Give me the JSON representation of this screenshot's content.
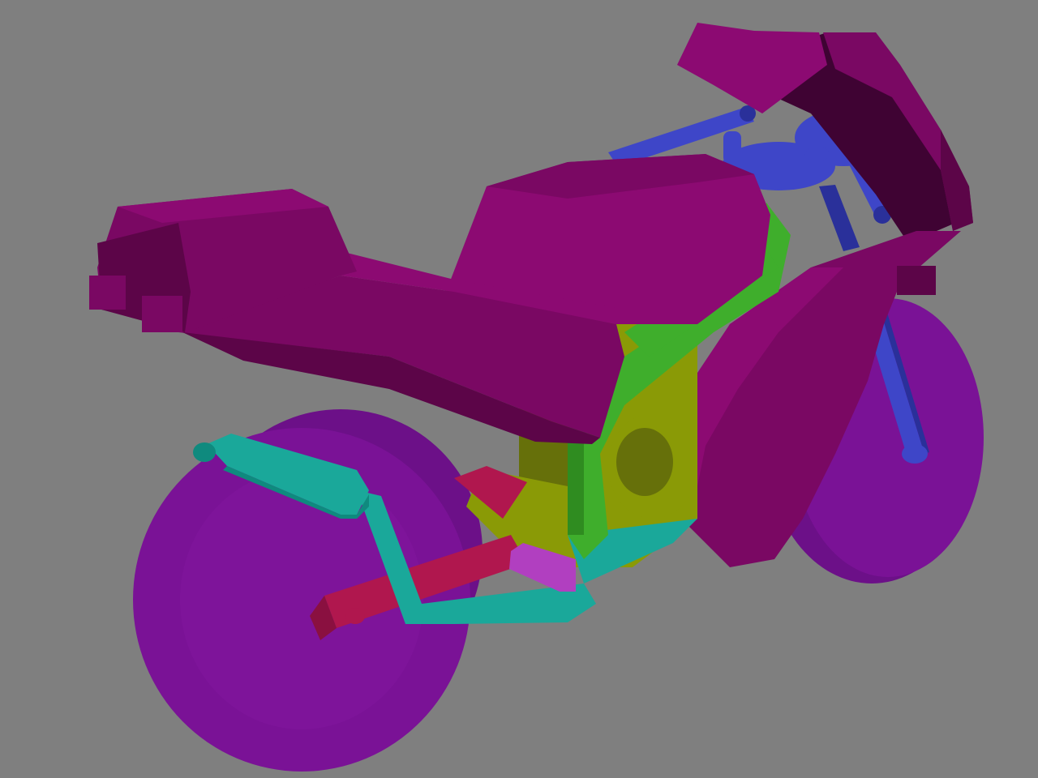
{
  "scene": {
    "background": "#7f7f7f"
  },
  "palette": {
    "body_panel_light": "#8c0a72",
    "body_panel_mid": "#7a0863",
    "body_panel_dark": "#5c0548",
    "body_panel_inner": "#3f0333",
    "wheel_face": "#7a1296",
    "wheel_face_shade": "#6c1088",
    "wheel_rim": "#8a1aa6",
    "frame_green": "#3fae2c",
    "frame_green_dark": "#2f8c20",
    "engine_olive": "#8a9a06",
    "engine_olive_dark": "#66700a",
    "exhaust_teal": "#1aa89a",
    "exhaust_teal_dark": "#0f8a7e",
    "swingarm_crimson": "#b0174e",
    "swingarm_crimson_dark": "#8a1040",
    "fork_blue": "#3e46c8",
    "fork_blue_dark": "#2a309a",
    "footpeg_violet": "#b13fc0"
  }
}
